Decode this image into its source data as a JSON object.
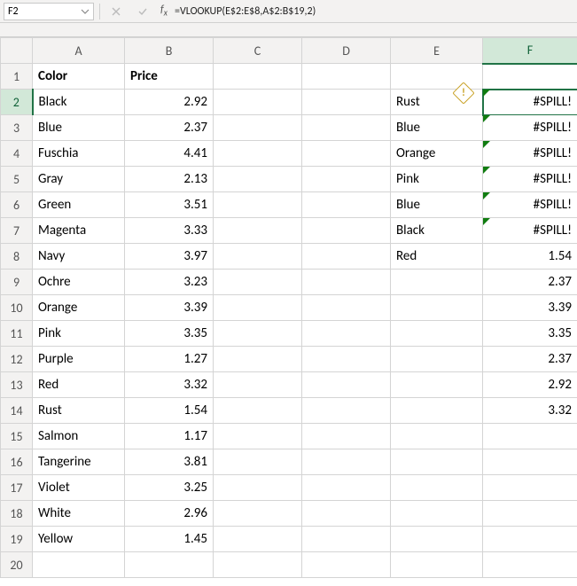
{
  "formula_bar": {
    "name_box": "F2",
    "formula": "=VLOOKUP(E$2:E$8,A$2:B$19,2)"
  },
  "column_headers": [
    "A",
    "B",
    "C",
    "D",
    "E",
    "F"
  ],
  "row_headers": [
    "1",
    "2",
    "3",
    "4",
    "5",
    "6",
    "7",
    "8",
    "9",
    "10",
    "11",
    "12",
    "13",
    "14",
    "15",
    "16",
    "17",
    "18",
    "19",
    "20"
  ],
  "headers": {
    "A": "Color",
    "B": "Price"
  },
  "table_ab": [
    {
      "color": "Black",
      "price": "2.92"
    },
    {
      "color": "Blue",
      "price": "2.37"
    },
    {
      "color": "Fuschia",
      "price": "4.41"
    },
    {
      "color": "Gray",
      "price": "2.13"
    },
    {
      "color": "Green",
      "price": "3.51"
    },
    {
      "color": "Magenta",
      "price": "3.33"
    },
    {
      "color": "Navy",
      "price": "3.97"
    },
    {
      "color": "Ochre",
      "price": "3.23"
    },
    {
      "color": "Orange",
      "price": "3.39"
    },
    {
      "color": "Pink",
      "price": "3.35"
    },
    {
      "color": "Purple",
      "price": "1.27"
    },
    {
      "color": "Red",
      "price": "3.32"
    },
    {
      "color": "Rust",
      "price": "1.54"
    },
    {
      "color": "Salmon",
      "price": "1.17"
    },
    {
      "color": "Tangerine",
      "price": "3.81"
    },
    {
      "color": "Violet",
      "price": "3.25"
    },
    {
      "color": "White",
      "price": "2.96"
    },
    {
      "color": "Yellow",
      "price": "1.45"
    }
  ],
  "lookup_e": [
    "Rust",
    "Blue",
    "Orange",
    "Pink",
    "Blue",
    "Black",
    "Red"
  ],
  "col_f": [
    "#SPILL!",
    "#SPILL!",
    "#SPILL!",
    "#SPILL!",
    "#SPILL!",
    "#SPILL!",
    "1.54",
    "2.37",
    "3.39",
    "3.35",
    "2.37",
    "2.92",
    "3.32"
  ],
  "error_badge": "!"
}
